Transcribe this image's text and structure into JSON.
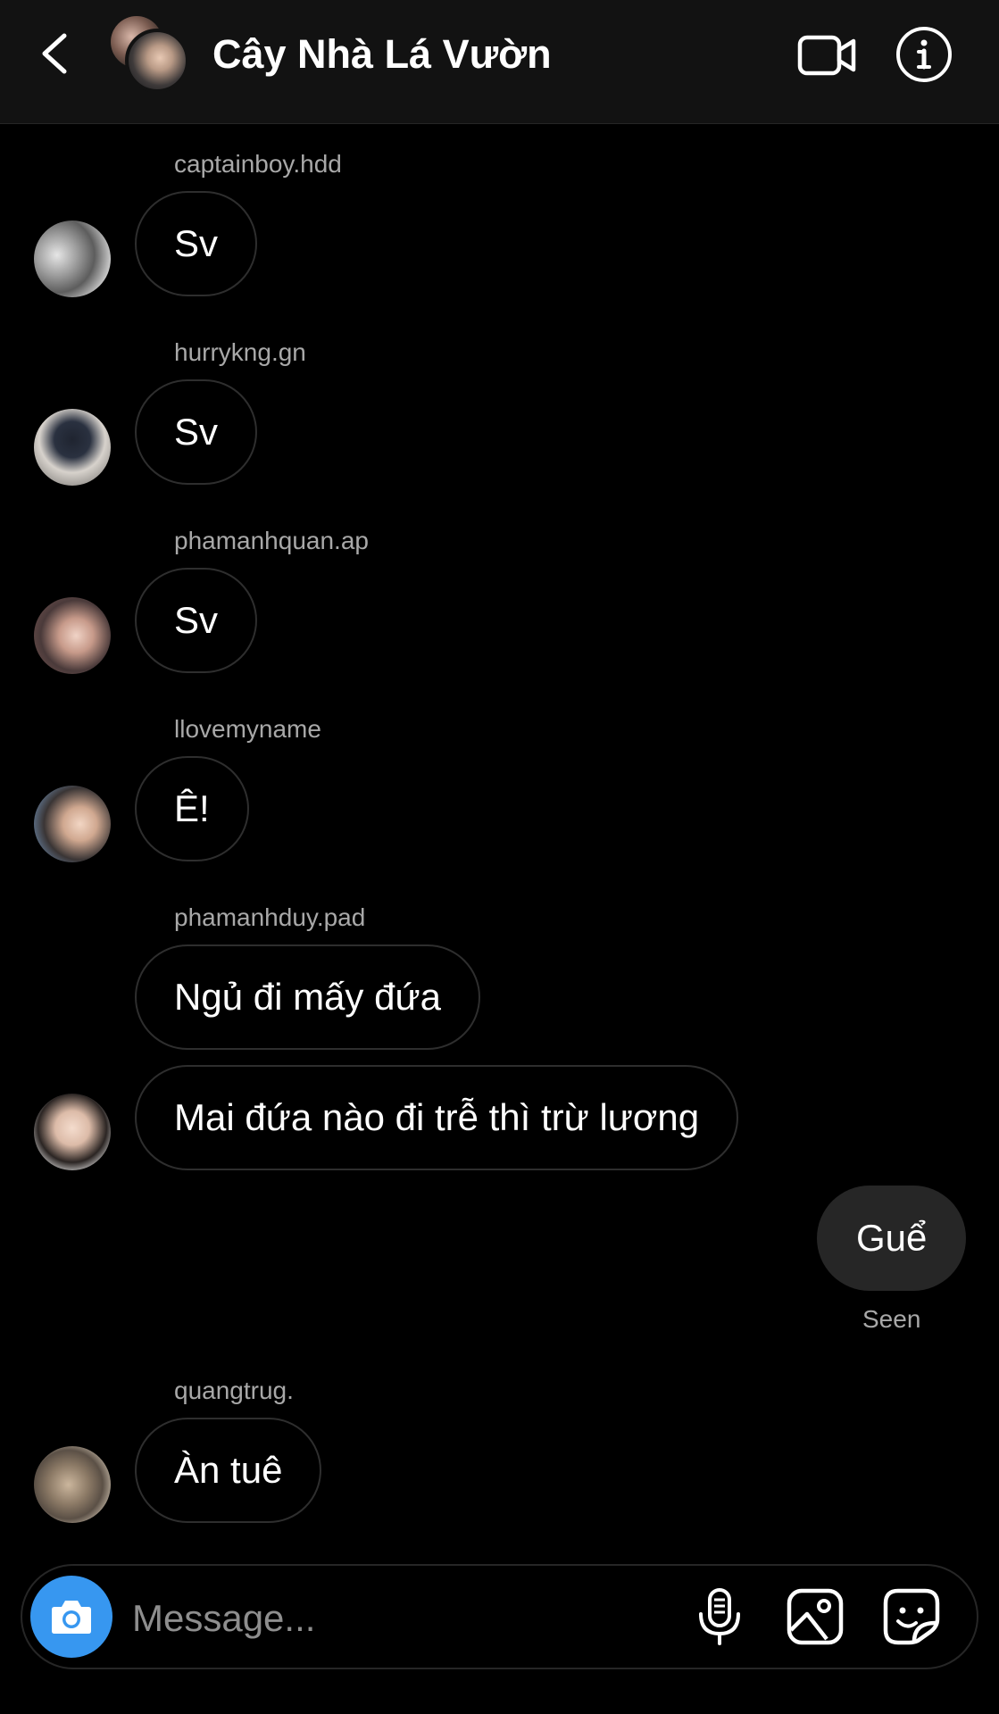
{
  "header": {
    "title": "Cây Nhà Lá Vườn",
    "icons": {
      "back": "chevron-left-icon",
      "video": "video-camera-icon",
      "info": "info-icon"
    }
  },
  "messages": [
    {
      "username": "captainboy.hdd",
      "text": "Sv"
    },
    {
      "username": "hurrykng.gn",
      "text": "Sv"
    },
    {
      "username": "phamanhquan.ap",
      "text": "Sv"
    },
    {
      "username": "llovemyname",
      "text": "Ê!"
    },
    {
      "username": "phamanhduy.pad",
      "texts": [
        "Ngủ đi mấy đứa",
        "Mai đứa nào đi trễ thì trừ lương"
      ]
    },
    {
      "self": true,
      "text": "Guể",
      "status": "Seen"
    },
    {
      "username": "quangtrug.",
      "text": "Àn tuê"
    }
  ],
  "composer": {
    "placeholder": "Message...",
    "value": "",
    "icons": {
      "camera": "camera-icon",
      "mic": "microphone-icon",
      "gallery": "image-icon",
      "sticker": "sticker-icon"
    },
    "accent_color": "#3797f0"
  },
  "colors": {
    "background": "#000000",
    "header": "#121212",
    "own_bubble": "#262626",
    "bubble_border": "#2e2e2e",
    "secondary_text": "#a8a8a8"
  }
}
